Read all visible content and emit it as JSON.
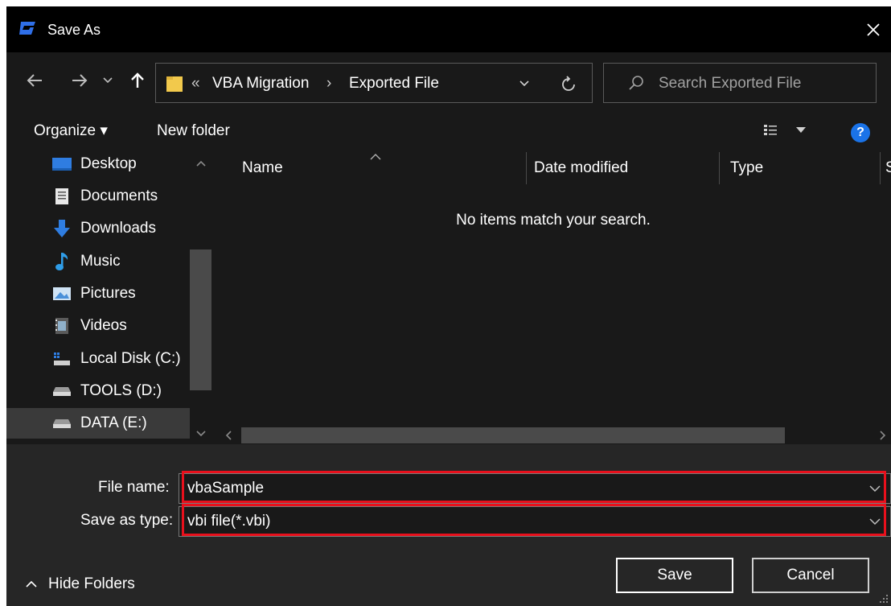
{
  "window": {
    "title": "Save As",
    "app_icon": "app-logo-icon",
    "close_icon": "close-icon"
  },
  "address": {
    "overflow": "«",
    "crumbs": [
      "VBA Migration",
      "Exported File"
    ],
    "separator": "›",
    "search_placeholder": "Search Exported File"
  },
  "toolbar": {
    "organize_label": "Organize ▾",
    "new_folder_label": "New folder",
    "help_label": "?"
  },
  "sidebar": {
    "items": [
      {
        "label": "Desktop",
        "icon": "desktop-icon"
      },
      {
        "label": "Documents",
        "icon": "documents-icon"
      },
      {
        "label": "Downloads",
        "icon": "downloads-icon"
      },
      {
        "label": "Music",
        "icon": "music-icon"
      },
      {
        "label": "Pictures",
        "icon": "pictures-icon"
      },
      {
        "label": "Videos",
        "icon": "videos-icon"
      },
      {
        "label": "Local Disk (C:)",
        "icon": "local-disk-icon"
      },
      {
        "label": "TOOLS (D:)",
        "icon": "drive-icon"
      },
      {
        "label": "DATA (E:)",
        "icon": "drive-icon"
      }
    ],
    "selected_index": 8
  },
  "content": {
    "columns": [
      "Name",
      "Date modified",
      "Type",
      "S"
    ],
    "empty_message": "No items match your search."
  },
  "form": {
    "file_name_label": "File name:",
    "file_name_value": "vbaSample",
    "save_type_label": "Save as type:",
    "save_type_value": "vbi file(*.vbi)"
  },
  "buttons": {
    "save": "Save",
    "cancel": "Cancel",
    "hide_folders": "Hide Folders"
  },
  "colors": {
    "background": "#191919",
    "titlebar": "#000000",
    "bottom_panel": "#262626",
    "highlight": "#e8101c",
    "help_blue": "#1a73e8",
    "folder_yellow": "#f2c94c"
  }
}
